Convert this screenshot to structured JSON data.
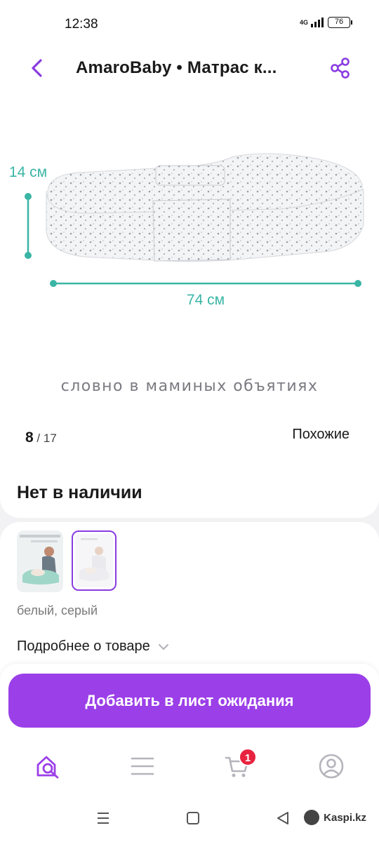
{
  "status_bar": {
    "time": "12:38",
    "network": "4G",
    "battery": "76"
  },
  "header": {
    "title": "AmaroBaby • Матрас к...",
    "back_icon": "chevron-left-icon",
    "share_icon": "share-icon"
  },
  "gallery": {
    "dimension_height": "14 см",
    "dimension_width": "74 см",
    "tagline": "словно в маминых объятиях",
    "current": "8",
    "total": "/ 17",
    "similar_label": "Похожие"
  },
  "availability": {
    "status": "Нет в наличии"
  },
  "variants": {
    "color_label": "белый, серый",
    "details_link": "Подробнее о товаре"
  },
  "cta": {
    "label": "Добавить в лист ожидания"
  },
  "tabbar": {
    "items": [
      "home-search-icon",
      "menu-icon",
      "cart-icon",
      "profile-icon"
    ],
    "cart_badge": "1"
  },
  "colors": {
    "accent": "#9b3fe8",
    "dimension": "#3ab5a5",
    "badge": "#e8233f"
  },
  "watermark": {
    "text": "Kaspi.kz"
  }
}
